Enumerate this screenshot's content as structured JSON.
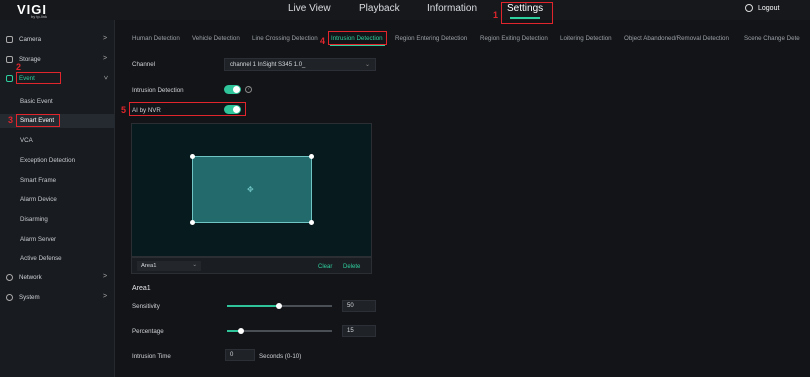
{
  "brand": {
    "name": "VIGI",
    "sub": "by tp-link"
  },
  "topnav": {
    "items": [
      "Live View",
      "Playback",
      "Information",
      "Settings"
    ],
    "active": "Settings",
    "logout": "Logout"
  },
  "sidebar": {
    "items": [
      {
        "label": "Camera",
        "icon": "camera-icon"
      },
      {
        "label": "Storage",
        "icon": "storage-icon"
      },
      {
        "label": "Event",
        "icon": "event-icon"
      },
      {
        "label": "Network",
        "icon": "network-icon"
      },
      {
        "label": "System",
        "icon": "system-icon"
      }
    ],
    "event_sub": [
      "Basic Event",
      "Smart Event",
      "VCA",
      "Exception Detection",
      "Smart Frame",
      "Alarm Device",
      "Disarming",
      "Alarm Server",
      "Active Defense"
    ]
  },
  "tabs": [
    "Human Detection",
    "Vehicle Detection",
    "Line Crossing Detection",
    "Intrusion Detection",
    "Region Entering Detection",
    "Region Exiting Detection",
    "Loitering Detection",
    "Object Abandoned/Removal Detection",
    "Scene Change Dete"
  ],
  "form": {
    "channel_label": "Channel",
    "channel_value": "channel 1 InSight S345 1.0_",
    "intrusion_label": "Intrusion Detection",
    "ai_label": "AI by NVR",
    "help": "?"
  },
  "area": {
    "selected": "Area1",
    "clear": "Clear",
    "delete": "Delete",
    "heading": "Area1"
  },
  "settings": {
    "sensitivity_label": "Sensitivity",
    "sensitivity_value": "50",
    "percentage_label": "Percentage",
    "percentage_value": "15",
    "time_label": "Intrusion Time",
    "time_value": "0",
    "time_unit": "Seconds (0-10)"
  },
  "annotations": [
    "1",
    "2",
    "3",
    "4",
    "5"
  ],
  "colors": {
    "accent": "#2fd0a0",
    "annotation": "#e0262c",
    "toggle_on": "#2fc49a"
  },
  "chev": ">",
  "caret": "⌄"
}
